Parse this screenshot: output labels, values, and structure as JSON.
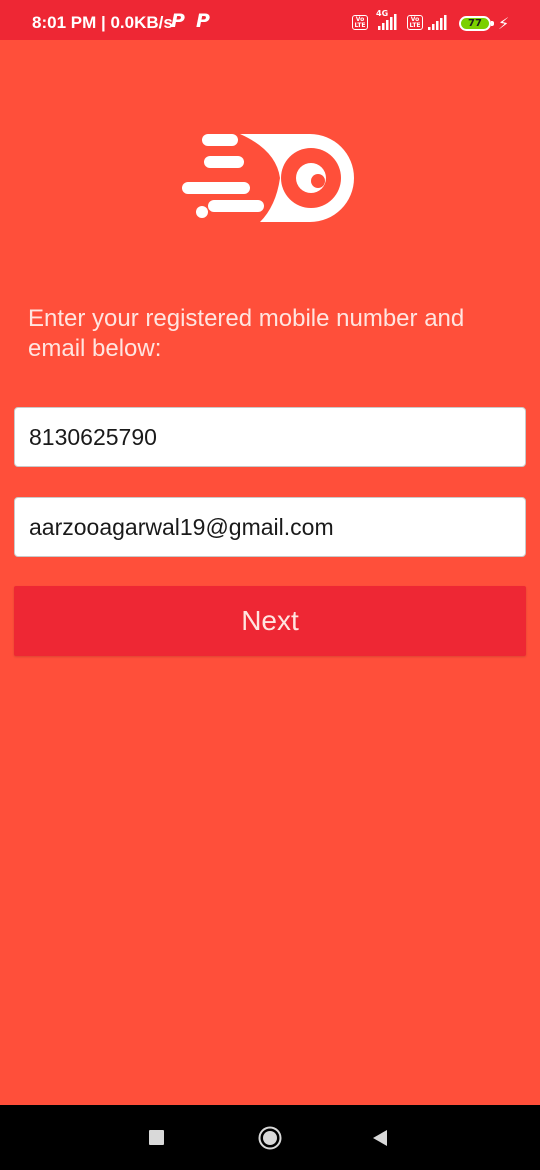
{
  "status_bar": {
    "time": "8:01 PM | 0.0KB/s",
    "notification_icons": [
      "P",
      "P"
    ],
    "volte_label": "Vo LTE",
    "network_label": "4G",
    "battery_level": "77",
    "charging": true
  },
  "logo": {
    "icon": "flying-eye-logo"
  },
  "form": {
    "instructions": "Enter your registered mobile number and email below:",
    "mobile_value": "8130625790",
    "email_value": "aarzooagarwal19@gmail.com",
    "next_label": "Next"
  },
  "nav_bar": {
    "recent_icon": "square-icon",
    "home_icon": "circle-icon",
    "back_icon": "triangle-back-icon"
  },
  "colors": {
    "background": "#FF4F3A",
    "accent": "#EE2734",
    "text_light": "#FFE5E0"
  }
}
